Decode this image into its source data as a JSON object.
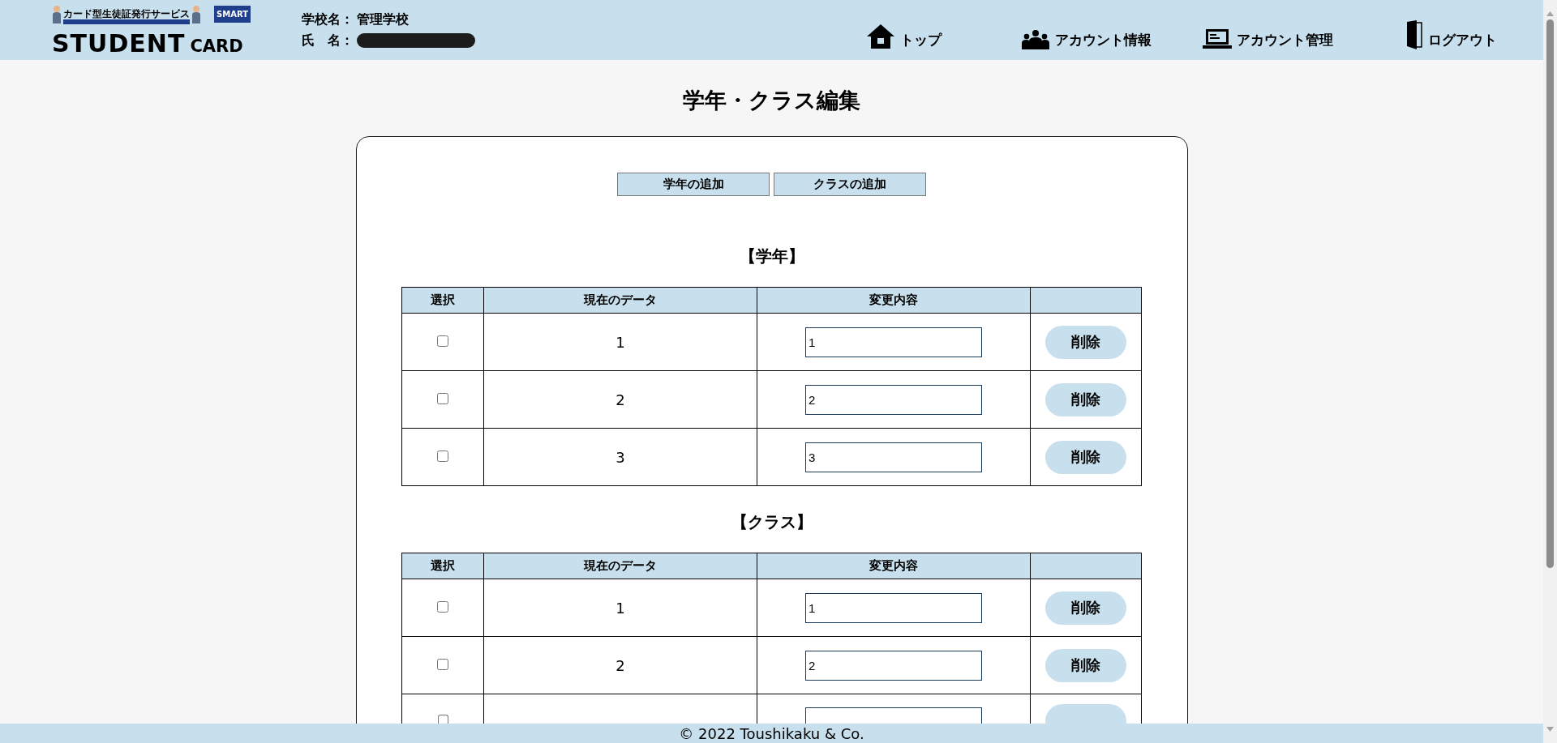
{
  "header": {
    "logo": {
      "tagline": "カード型生徒証発行サービス",
      "badge": "SMART",
      "word": "STUDENT",
      "word2": "CARD"
    },
    "school_label": "学校名：",
    "school": "管理学校",
    "name_label": "氏　名：",
    "nav": [
      {
        "kind": "home",
        "label": "トップ"
      },
      {
        "kind": "people",
        "label": "アカウント情報"
      },
      {
        "kind": "laptop",
        "label": "アカウント管理"
      },
      {
        "kind": "door",
        "label": "ログアウト"
      }
    ]
  },
  "title": "学年・クラス編集",
  "actions": [
    "学年の追加",
    "クラスの追加"
  ],
  "sections": [
    {
      "heading": "【学年】",
      "columns": [
        "選択",
        "現在のデータ",
        "変更内容"
      ],
      "rows": [
        {
          "checked": false,
          "current": "1",
          "value": "1",
          "button": "削除"
        },
        {
          "checked": false,
          "current": "2",
          "value": "2",
          "button": "削除"
        },
        {
          "checked": false,
          "current": "3",
          "value": "3",
          "button": "削除"
        }
      ]
    },
    {
      "heading": "【クラス】",
      "columns": [
        "選択",
        "現在のデータ",
        "変更内容"
      ],
      "rows": [
        {
          "checked": false,
          "current": "1",
          "value": "1",
          "button": "削除"
        },
        {
          "checked": false,
          "current": "2",
          "value": "2",
          "button": "削除"
        },
        {
          "checked": false
        }
      ]
    }
  ],
  "footer": "© 2022 Toushikaku & Co."
}
